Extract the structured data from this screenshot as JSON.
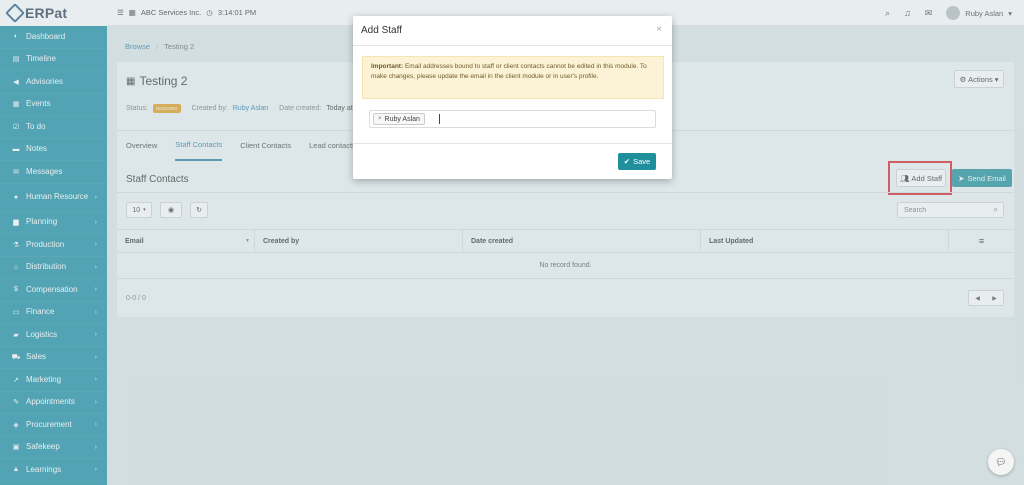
{
  "app": {
    "logo_text": "ERPat"
  },
  "topbar": {
    "company": "ABC Services Inc.",
    "time": "3:14:01 PM",
    "user_name": "Ruby Aslan"
  },
  "sidebar": {
    "items": [
      {
        "label": "Dashboard",
        "icon": "dashboard-icon",
        "chevron": false
      },
      {
        "label": "Timeline",
        "icon": "timeline-icon",
        "chevron": false
      },
      {
        "label": "Advisories",
        "icon": "megaphone-icon",
        "chevron": false
      },
      {
        "label": "Events",
        "icon": "calendar-icon",
        "chevron": false
      },
      {
        "label": "To do",
        "icon": "checkbox-icon",
        "chevron": false
      },
      {
        "label": "Notes",
        "icon": "notes-icon",
        "chevron": false
      },
      {
        "label": "Messages",
        "icon": "envelope-icon",
        "chevron": false
      },
      {
        "label": "Human Resource",
        "icon": "users-icon",
        "chevron": true
      },
      {
        "label": "Planning",
        "icon": "briefcase-icon",
        "chevron": true
      },
      {
        "label": "Production",
        "icon": "flask-icon",
        "chevron": true
      },
      {
        "label": "Distribution",
        "icon": "bank-icon",
        "chevron": true
      },
      {
        "label": "Compensation",
        "icon": "money-icon",
        "chevron": true
      },
      {
        "label": "Finance",
        "icon": "money-bill-icon",
        "chevron": true
      },
      {
        "label": "Logistics",
        "icon": "truck-icon",
        "chevron": true
      },
      {
        "label": "Sales",
        "icon": "cart-icon",
        "chevron": true
      },
      {
        "label": "Marketing",
        "icon": "chart-icon",
        "chevron": true
      },
      {
        "label": "Appointments",
        "icon": "edit-icon",
        "chevron": true
      },
      {
        "label": "Procurement",
        "icon": "cubes-icon",
        "chevron": true
      },
      {
        "label": "Safekeep",
        "icon": "box-icon",
        "chevron": true
      },
      {
        "label": "Learnings",
        "icon": "graduation-icon",
        "chevron": true
      }
    ]
  },
  "breadcrumb": {
    "root": "Browse",
    "sep": "/",
    "current": "Testing 2"
  },
  "project": {
    "title": "Testing 2",
    "actions_label": "Actions",
    "status_label": "Status:",
    "status_value": "ONGOING",
    "created_by_label": "Created by:",
    "created_by_value": "Ruby Aslan",
    "date_created_label": "Date created:",
    "date_created_value": "Today at"
  },
  "tabs": [
    {
      "label": "Overview",
      "active": false
    },
    {
      "label": "Staff Contacts",
      "active": true
    },
    {
      "label": "Client Contacts",
      "active": false
    },
    {
      "label": "Lead contacts",
      "active": false
    }
  ],
  "staff_contacts": {
    "title": "Staff Contacts",
    "add_staff_label": "Add Staff",
    "send_email_label": "Send Email",
    "page_size": "10",
    "search_placeholder": "Search",
    "columns": [
      "Email",
      "Created by",
      "Date created",
      "Last Updated"
    ],
    "empty_text": "No record found.",
    "count_text": "0-0 / 0"
  },
  "modal": {
    "title": "Add Staff",
    "notice_bold": "Important:",
    "notice_text": " Email addresses bound to staff or client contacts cannot be edited in this module. To make changes, please update the email in the client module or in user's profile.",
    "tag_label": "Ruby Aslan",
    "save_label": "Save"
  }
}
